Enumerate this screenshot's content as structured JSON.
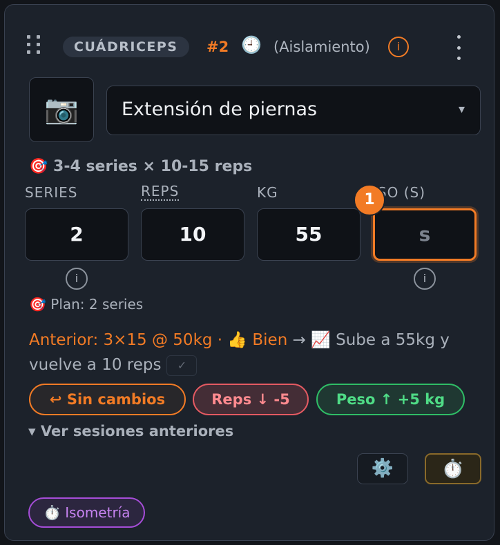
{
  "header": {
    "muscle_group": "CUÁDRICEPS",
    "order": "#2",
    "clock_icon": "clock-icon",
    "exercise_type": "(Aislamiento)",
    "info_glyph": "i"
  },
  "exercise": {
    "camera_icon": "📷",
    "clock_glyph": "🕘",
    "name": "Extensión de piernas",
    "dropdown_arrow": "▾"
  },
  "target": "🎯 3-4 series × 10-15 reps",
  "fields": [
    {
      "label": "SERIES",
      "value": "2"
    },
    {
      "label": "REPS",
      "value": "10"
    },
    {
      "label": "KG",
      "value": "55"
    },
    {
      "label": "PESO (S)",
      "label_visible": "ISO (S)",
      "value": "s"
    }
  ],
  "step_badge": "1",
  "plan": "🎯 Plan: 2 series",
  "previous": {
    "prefix": "Anterior: 3×15 @ 50kg · 👍 Bien",
    "arrow": " → 📈 ",
    "suggestion": "Sube a 55kg y vuelve a 10 reps",
    "check": "✓"
  },
  "actions": {
    "no_change": "↩ Sin cambios",
    "reps_down": "Reps ↓ -5",
    "weight_up": "Peso ↑ +5 kg"
  },
  "history_toggle": "▾ Ver sesiones anteriores",
  "tools": {
    "settings": "⚙️",
    "timer": "⏱️"
  },
  "tag": "⏱️ Isometría",
  "colors": {
    "accent": "#f27b25",
    "danger": "#e45a62",
    "success": "#2fbd66",
    "purple": "#a64dd8",
    "card_bg": "#1c222b"
  }
}
